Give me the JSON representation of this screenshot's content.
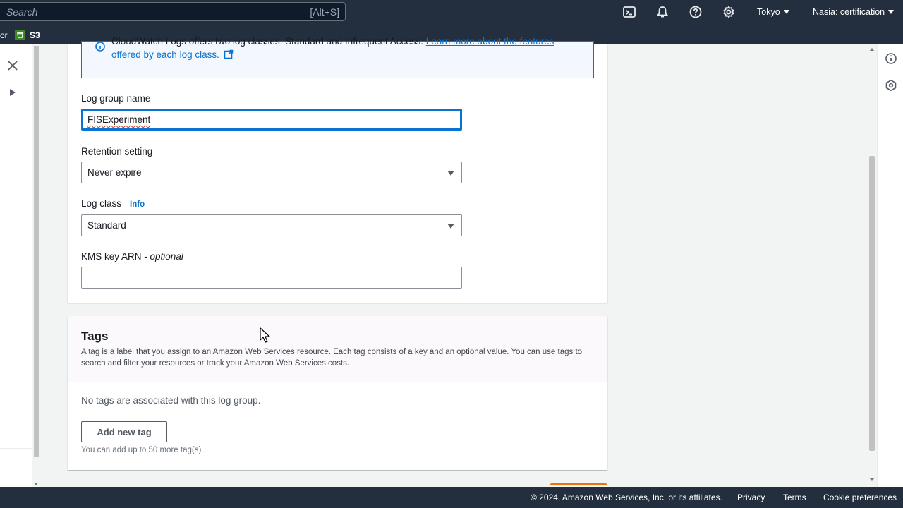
{
  "topnav": {
    "search_placeholder": "Search",
    "search_shortcut": "[Alt+S]",
    "icons": [
      "terminal-icon",
      "bell-icon",
      "help-icon",
      "gear-icon"
    ],
    "region": "Tokyo",
    "account": "Nasia: certification"
  },
  "favorites": {
    "partial_label": "or",
    "s3_label": "S3"
  },
  "alert": {
    "text": "CloudWatch Logs offers two log classes: Standard and Infrequent Access. ",
    "link_part1": "Learn more about the features",
    "link_part2": "offered by each log class."
  },
  "form": {
    "log_group_name_label": "Log group name",
    "log_group_name_value": "FISExperiment",
    "retention_label": "Retention setting",
    "retention_value": "Never expire",
    "log_class_label": "Log class",
    "log_class_info": "Info",
    "log_class_value": "Standard",
    "kms_label": "KMS key ARN - ",
    "kms_optional": "optional",
    "kms_value": ""
  },
  "tags": {
    "title": "Tags",
    "description": "A tag is a label that you assign to an Amazon Web Services resource. Each tag consists of a key and an optional value. You can use tags to search and filter your resources or track your Amazon Web Services costs.",
    "empty_text": "No tags are associated with this log group.",
    "add_button": "Add new tag",
    "hint": "You can add up to 50 more tag(s)."
  },
  "footer": {
    "copyright": "© 2024, Amazon Web Services, Inc. or its affiliates.",
    "privacy": "Privacy",
    "terms": "Terms",
    "cookies": "Cookie preferences"
  },
  "colors": {
    "nav_bg": "#232f3e",
    "link": "#0972d3",
    "s3_green": "#3f8624",
    "focus": "#0972d3"
  }
}
